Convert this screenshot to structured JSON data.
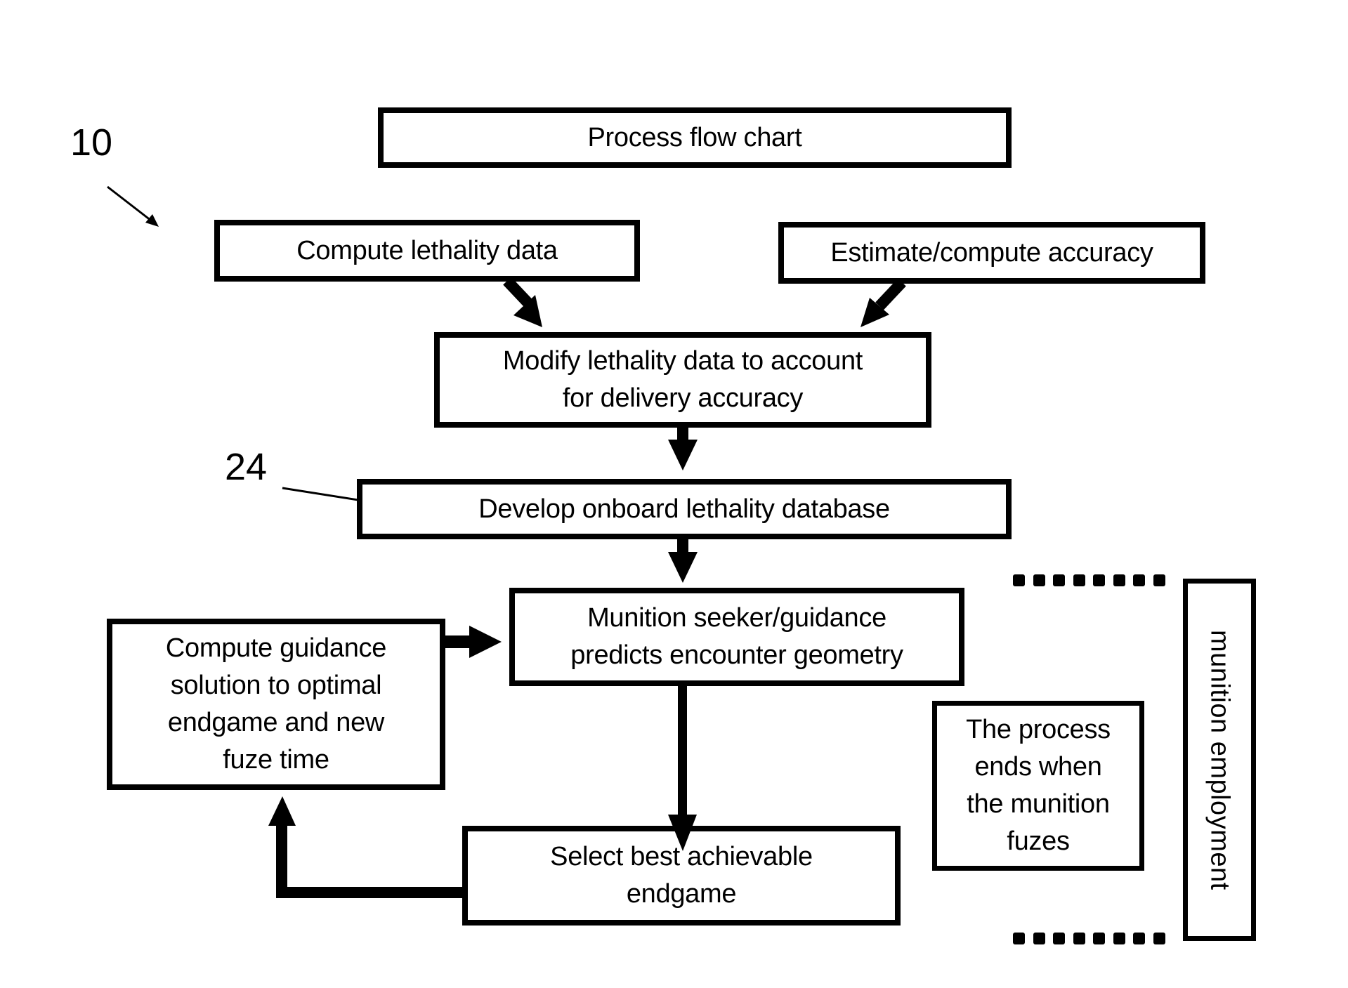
{
  "figure": {
    "reference_numerals": {
      "figure": "10",
      "database": "24"
    },
    "title_box": "Process flow chart",
    "steps": {
      "compute_lethality": "Compute lethality data",
      "estimate_accuracy": "Estimate/compute accuracy",
      "modify_lethality": "Modify lethality data to account\nfor delivery accuracy",
      "develop_database": "Develop onboard lethality database",
      "seeker_guidance": "Munition seeker/guidance\npredicts encounter geometry",
      "compute_guidance": "Compute guidance\nsolution to optimal\nendgame and new\nfuze time",
      "select_endgame": "Select best achievable\nendgame",
      "process_ends": "The process\nends when\nthe munition\nfuzes"
    },
    "phase_label": "munition employment",
    "dotted_bracket_dots": 8,
    "flow": [
      {
        "from": "compute_lethality",
        "to": "modify_lethality"
      },
      {
        "from": "estimate_accuracy",
        "to": "modify_lethality"
      },
      {
        "from": "modify_lethality",
        "to": "develop_database"
      },
      {
        "from": "develop_database",
        "to": "seeker_guidance"
      },
      {
        "from": "seeker_guidance",
        "to": "select_endgame"
      },
      {
        "from": "select_endgame",
        "to": "compute_guidance"
      },
      {
        "from": "compute_guidance",
        "to": "seeker_guidance"
      }
    ]
  }
}
